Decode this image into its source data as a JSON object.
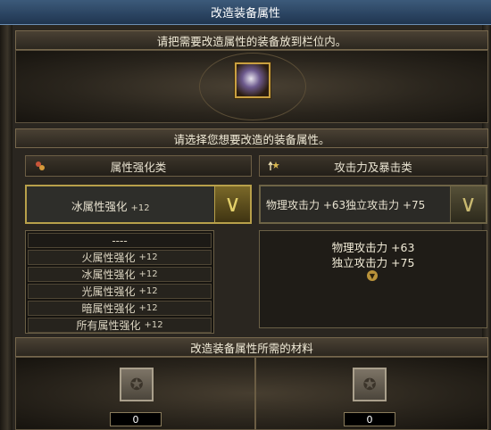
{
  "window": {
    "title": "改造装备属性"
  },
  "top_section": {
    "instruction": "请把需要改造属性的装备放到栏位内。"
  },
  "choose_section": {
    "instruction": "请选择您想要改造的装备属性。"
  },
  "left_column": {
    "header": "属性强化类",
    "header_icon": "elements-icon",
    "selected_label": "冰属性强化",
    "selected_value": "+12",
    "dropdown_separator": "----",
    "options": [
      {
        "label": "火属性强化",
        "value": "+12"
      },
      {
        "label": "冰属性强化",
        "value": "+12"
      },
      {
        "label": "光属性强化",
        "value": "+12"
      },
      {
        "label": "暗属性强化",
        "value": "+12"
      },
      {
        "label": "所有属性强化",
        "value": "+12"
      }
    ]
  },
  "right_column": {
    "header": "攻击力及暴击类",
    "header_icon": "attack-up-icon",
    "selected_text": "物理攻击力 +63独立攻击力 +75",
    "details": [
      "物理攻击力 +63",
      "独立攻击力 +75"
    ]
  },
  "materials_section": {
    "title": "改造装备属性所需的材料",
    "slots": [
      {
        "count": "0"
      },
      {
        "count": "0"
      }
    ]
  }
}
